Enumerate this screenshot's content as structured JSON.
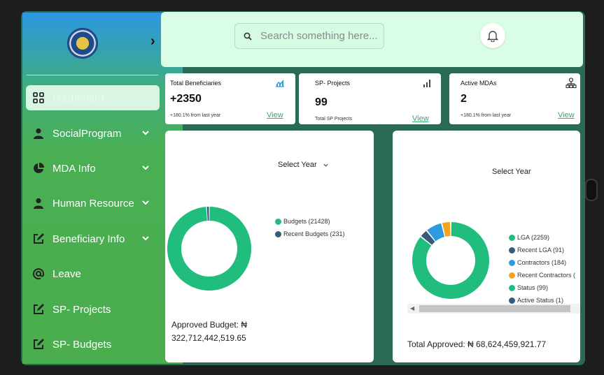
{
  "sidebar": {
    "items": [
      {
        "label": "Dashboard",
        "icon": "grid-icon",
        "active": true
      },
      {
        "label": "SocialProgram",
        "icon": "user-icon",
        "caret": true
      },
      {
        "label": "MDA Info",
        "icon": "pie-icon",
        "caret": true
      },
      {
        "label": "Human Resource",
        "icon": "user-icon",
        "caret": true
      },
      {
        "label": "Beneficiary Info",
        "icon": "edit-icon",
        "caret": true
      },
      {
        "label": "Leave",
        "icon": "at-icon"
      },
      {
        "label": "SP- Projects",
        "icon": "edit-icon"
      },
      {
        "label": "SP- Budgets",
        "icon": "edit-icon"
      }
    ]
  },
  "header": {
    "search_placeholder": "Search something here..."
  },
  "stats": [
    {
      "title": "Total Beneficiaries",
      "value": "+2350",
      "sub": "+180.1% from last year",
      "view": "View",
      "icon": "trend-chart-icon"
    },
    {
      "title": "SP- Projects",
      "value": "99",
      "sub": "Total SP Projects",
      "view": "View",
      "icon": "bar-chart-icon"
    },
    {
      "title": "Active MDAs",
      "value": "2",
      "sub": "+180.1% from last year",
      "view": "View",
      "icon": "org-chart-icon"
    }
  ],
  "budget_card": {
    "select_label": "Select Year",
    "legend": [
      {
        "label": "Budgets (21428)",
        "color": "#20bd7e"
      },
      {
        "label": "Recent Budgets (231)",
        "color": "#355c7d"
      }
    ],
    "total_label": "Approved Budget: ₦",
    "total_value": "322,712,442,519.65"
  },
  "lga_card": {
    "select_label": "Select Year",
    "legend": [
      {
        "label": "LGA (2259)",
        "color": "#20bd7e"
      },
      {
        "label": "Recent LGA (91)",
        "color": "#355c7d"
      },
      {
        "label": "Contractors (184)",
        "color": "#2e9be0"
      },
      {
        "label": "Recent Contractors (",
        "color": "#f5a31a"
      },
      {
        "label": "Status (99)",
        "color": "#20bd7e"
      },
      {
        "label": "Active Status (1)",
        "color": "#355c7d"
      }
    ],
    "total_label": "Total Approved: ₦ 68,624,459,921.77"
  },
  "chart_data": [
    {
      "type": "pie",
      "labels": [
        "Budgets",
        "Recent Budgets"
      ],
      "values": [
        21428,
        231
      ],
      "colors": [
        "#20bd7e",
        "#355c7d"
      ]
    },
    {
      "type": "pie",
      "labels": [
        "LGA",
        "Recent LGA",
        "Contractors",
        "Status",
        "Active Status"
      ],
      "values": [
        2259,
        91,
        184,
        99,
        1
      ],
      "colors": [
        "#20bd7e",
        "#355c7d",
        "#2e9be0",
        "#f5a31a",
        "#20bd7e"
      ]
    }
  ]
}
